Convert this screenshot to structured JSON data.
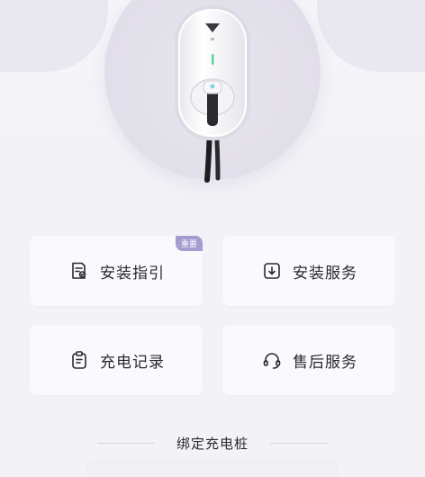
{
  "hero": {
    "image": "ev-charger-wallbox"
  },
  "cards": [
    {
      "label": "安装指引",
      "icon": "install-guide-icon",
      "badge": "重要"
    },
    {
      "label": "安装服务",
      "icon": "install-service-icon"
    },
    {
      "label": "充电记录",
      "icon": "charging-record-icon"
    },
    {
      "label": "售后服务",
      "icon": "headset-icon"
    }
  ],
  "footer": {
    "bind_label": "绑定充电桩"
  },
  "colors": {
    "background": "#f3f2f6",
    "card": "#fafafc",
    "badge": "#a79cd0",
    "accent_green": "#5ed69a"
  }
}
